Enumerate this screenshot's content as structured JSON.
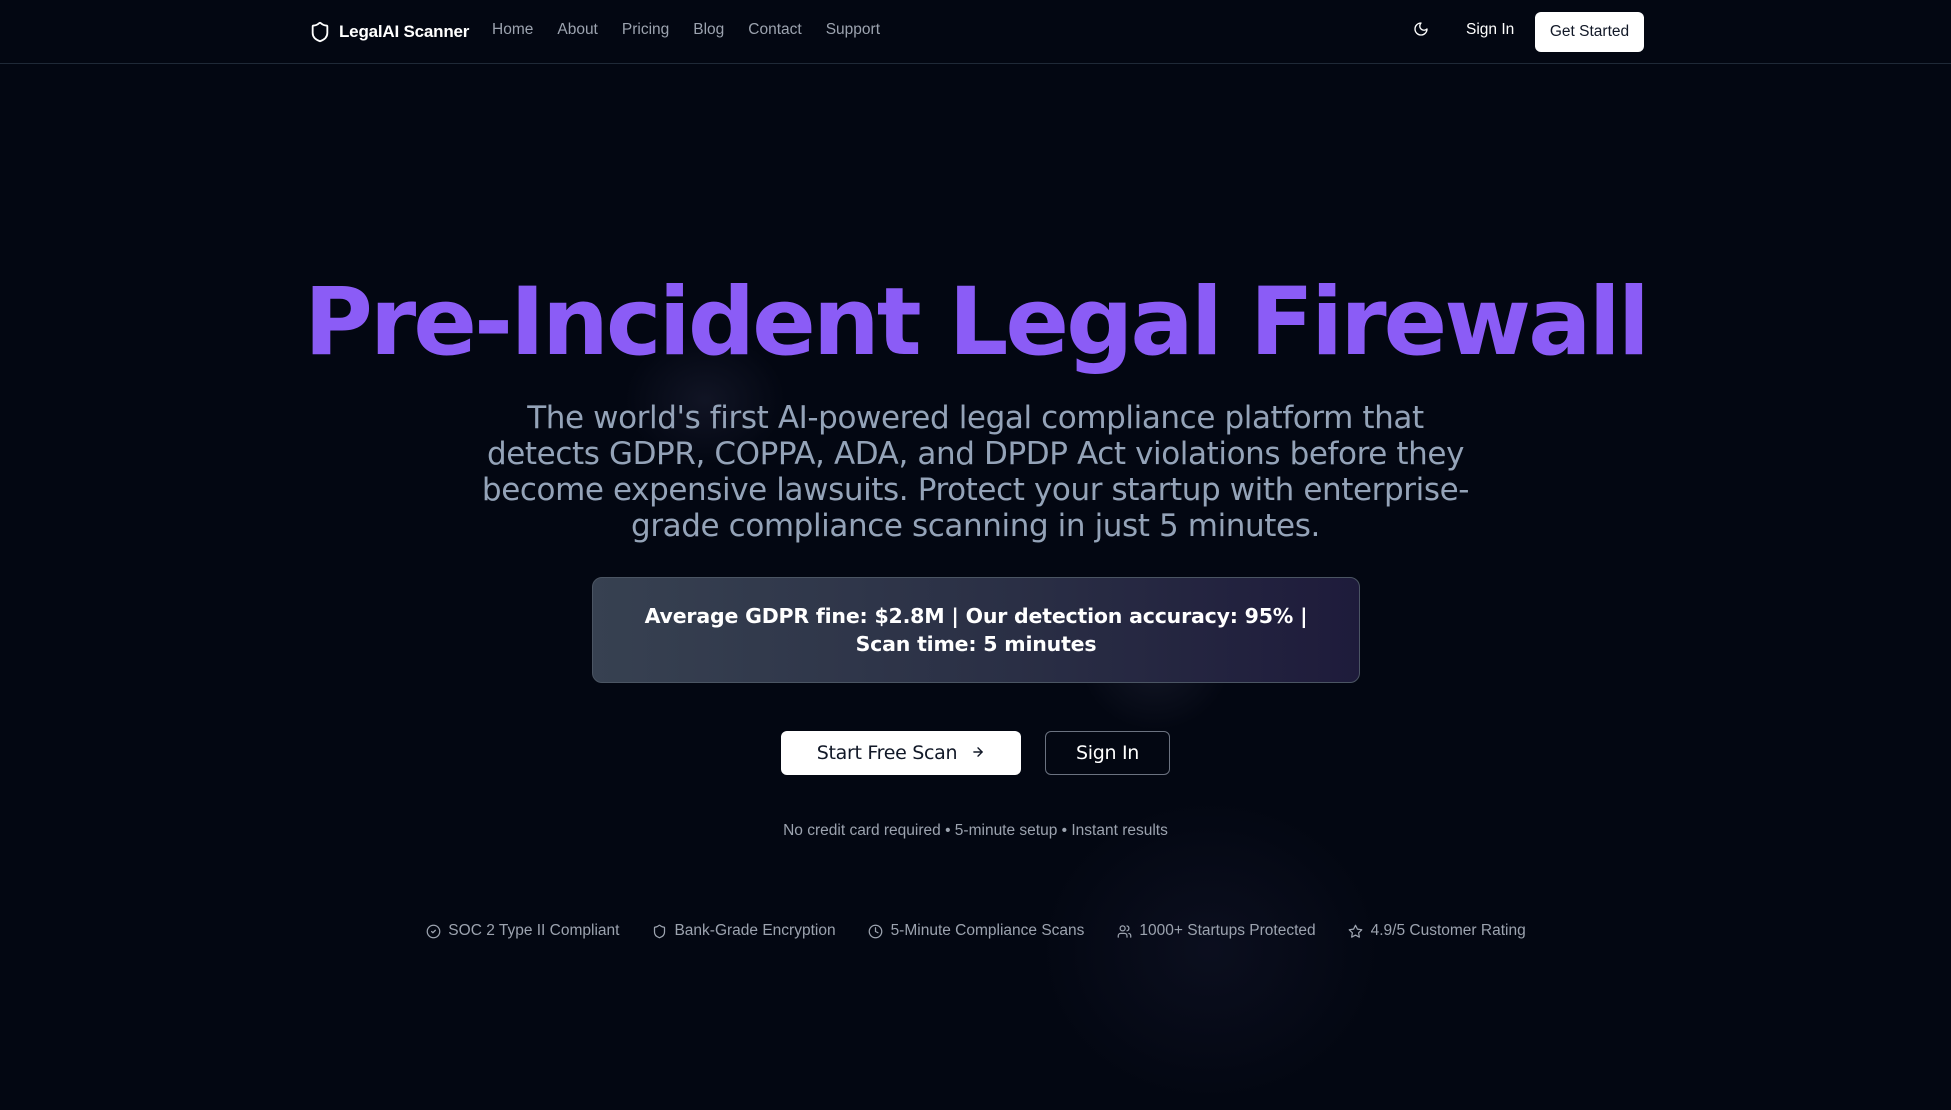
{
  "brand": {
    "name": "LegalAI Scanner",
    "icon": "shield-icon"
  },
  "nav": {
    "links": [
      "Home",
      "About",
      "Pricing",
      "Blog",
      "Contact",
      "Support"
    ],
    "theme_icon": "moon-icon",
    "sign_in": "Sign In",
    "get_started": "Get Started"
  },
  "hero": {
    "title": "Pre-Incident Legal Firewall",
    "subtitle": "The world's first AI-powered legal compliance platform that detects GDPR, COPPA, ADA, and DPDP Act violations before they become expensive lawsuits. Protect your startup with enterprise-grade compliance scanning in just 5 minutes.",
    "stats": "Average GDPR fine: $2.8M | Our detection accuracy: 95% | Scan time: 5 minutes",
    "primary_cta": "Start Free Scan",
    "primary_cta_icon": "arrow-right-icon",
    "secondary_cta": "Sign In",
    "note": "No credit card required • 5-minute setup • Instant results"
  },
  "badges": [
    {
      "icon": "check-circle-icon",
      "label": "SOC 2 Type II Compliant"
    },
    {
      "icon": "shield-icon",
      "label": "Bank-Grade Encryption"
    },
    {
      "icon": "clock-icon",
      "label": "5-Minute Compliance Scans"
    },
    {
      "icon": "users-icon",
      "label": "1000+ Startups Protected"
    },
    {
      "icon": "star-icon",
      "label": "4.9/5 Customer Rating"
    }
  ],
  "colors": {
    "background": "#030712",
    "accent": "#8b5cf6",
    "muted_text": "#9ca3af",
    "subtitle_text": "#94a3b8"
  }
}
